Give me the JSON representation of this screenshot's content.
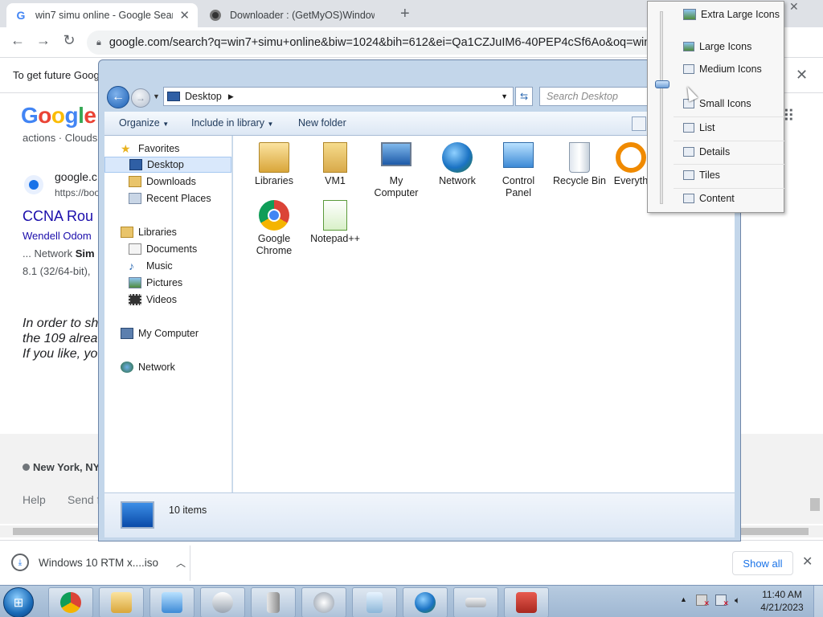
{
  "browser": {
    "tabs": [
      {
        "title": "win7 simu online - Google Search",
        "active": true
      },
      {
        "title": "Downloader : (GetMyOS)Windows",
        "active": false
      }
    ],
    "url": "google.com/search?q=win7+simu+online&biw=1024&bih=612&ei=Qa1CZJuIM6-40PEP4cSf6Ao&oq=win...",
    "infobar_text": "To get future Google",
    "page": {
      "logo": "Google",
      "snippet_top": "actions · Clouds",
      "result_site": "google.c",
      "result_url": "https://boo",
      "result_title": "CCNA Rou",
      "result_author": "Wendell Odom",
      "result_line1_prefix": "... Network ",
      "result_line1_bold": "Sim",
      "result_line2": "8.1 (32/64-bit),",
      "italic_lines": [
        "In order to sh",
        "the 109 alrea",
        "If you like, yo"
      ],
      "location": "New York, NY",
      "footer_help": "Help",
      "footer_send": "Send f"
    },
    "download": {
      "filename": "Windows 10 RTM x....iso",
      "show_all": "Show all"
    }
  },
  "explorer": {
    "address": "Desktop",
    "search_placeholder": "Search Desktop",
    "commands": [
      "Organize",
      "Include in library",
      "New folder"
    ],
    "nav": {
      "favorites": "Favorites",
      "favorite_items": [
        "Desktop",
        "Downloads",
        "Recent Places"
      ],
      "libraries": "Libraries",
      "library_items": [
        "Documents",
        "Music",
        "Pictures",
        "Videos"
      ],
      "computer": "My Computer",
      "network": "Network"
    },
    "icons": [
      [
        "Libraries"
      ],
      [
        "VM1"
      ],
      [
        "My",
        "Computer"
      ],
      [
        "Network"
      ],
      [
        "Control",
        "Panel"
      ],
      [
        "Recycle Bin"
      ],
      [
        "Everyth"
      ],
      [
        "Google",
        "Chrome"
      ],
      [
        "Notepad++"
      ]
    ],
    "item_count": "10 items"
  },
  "view_menu": {
    "items": [
      "Extra Large Icons",
      "Large Icons",
      "Medium Icons",
      "Small Icons",
      "List",
      "Details",
      "Tiles",
      "Content"
    ]
  },
  "taskbar": {
    "time": "11:40 AM",
    "date": "4/21/2023"
  },
  "colors": {
    "link_blue": "#1a0dab",
    "win_frame": "#c3d6ea",
    "taskbar": "#b7cbe0"
  }
}
